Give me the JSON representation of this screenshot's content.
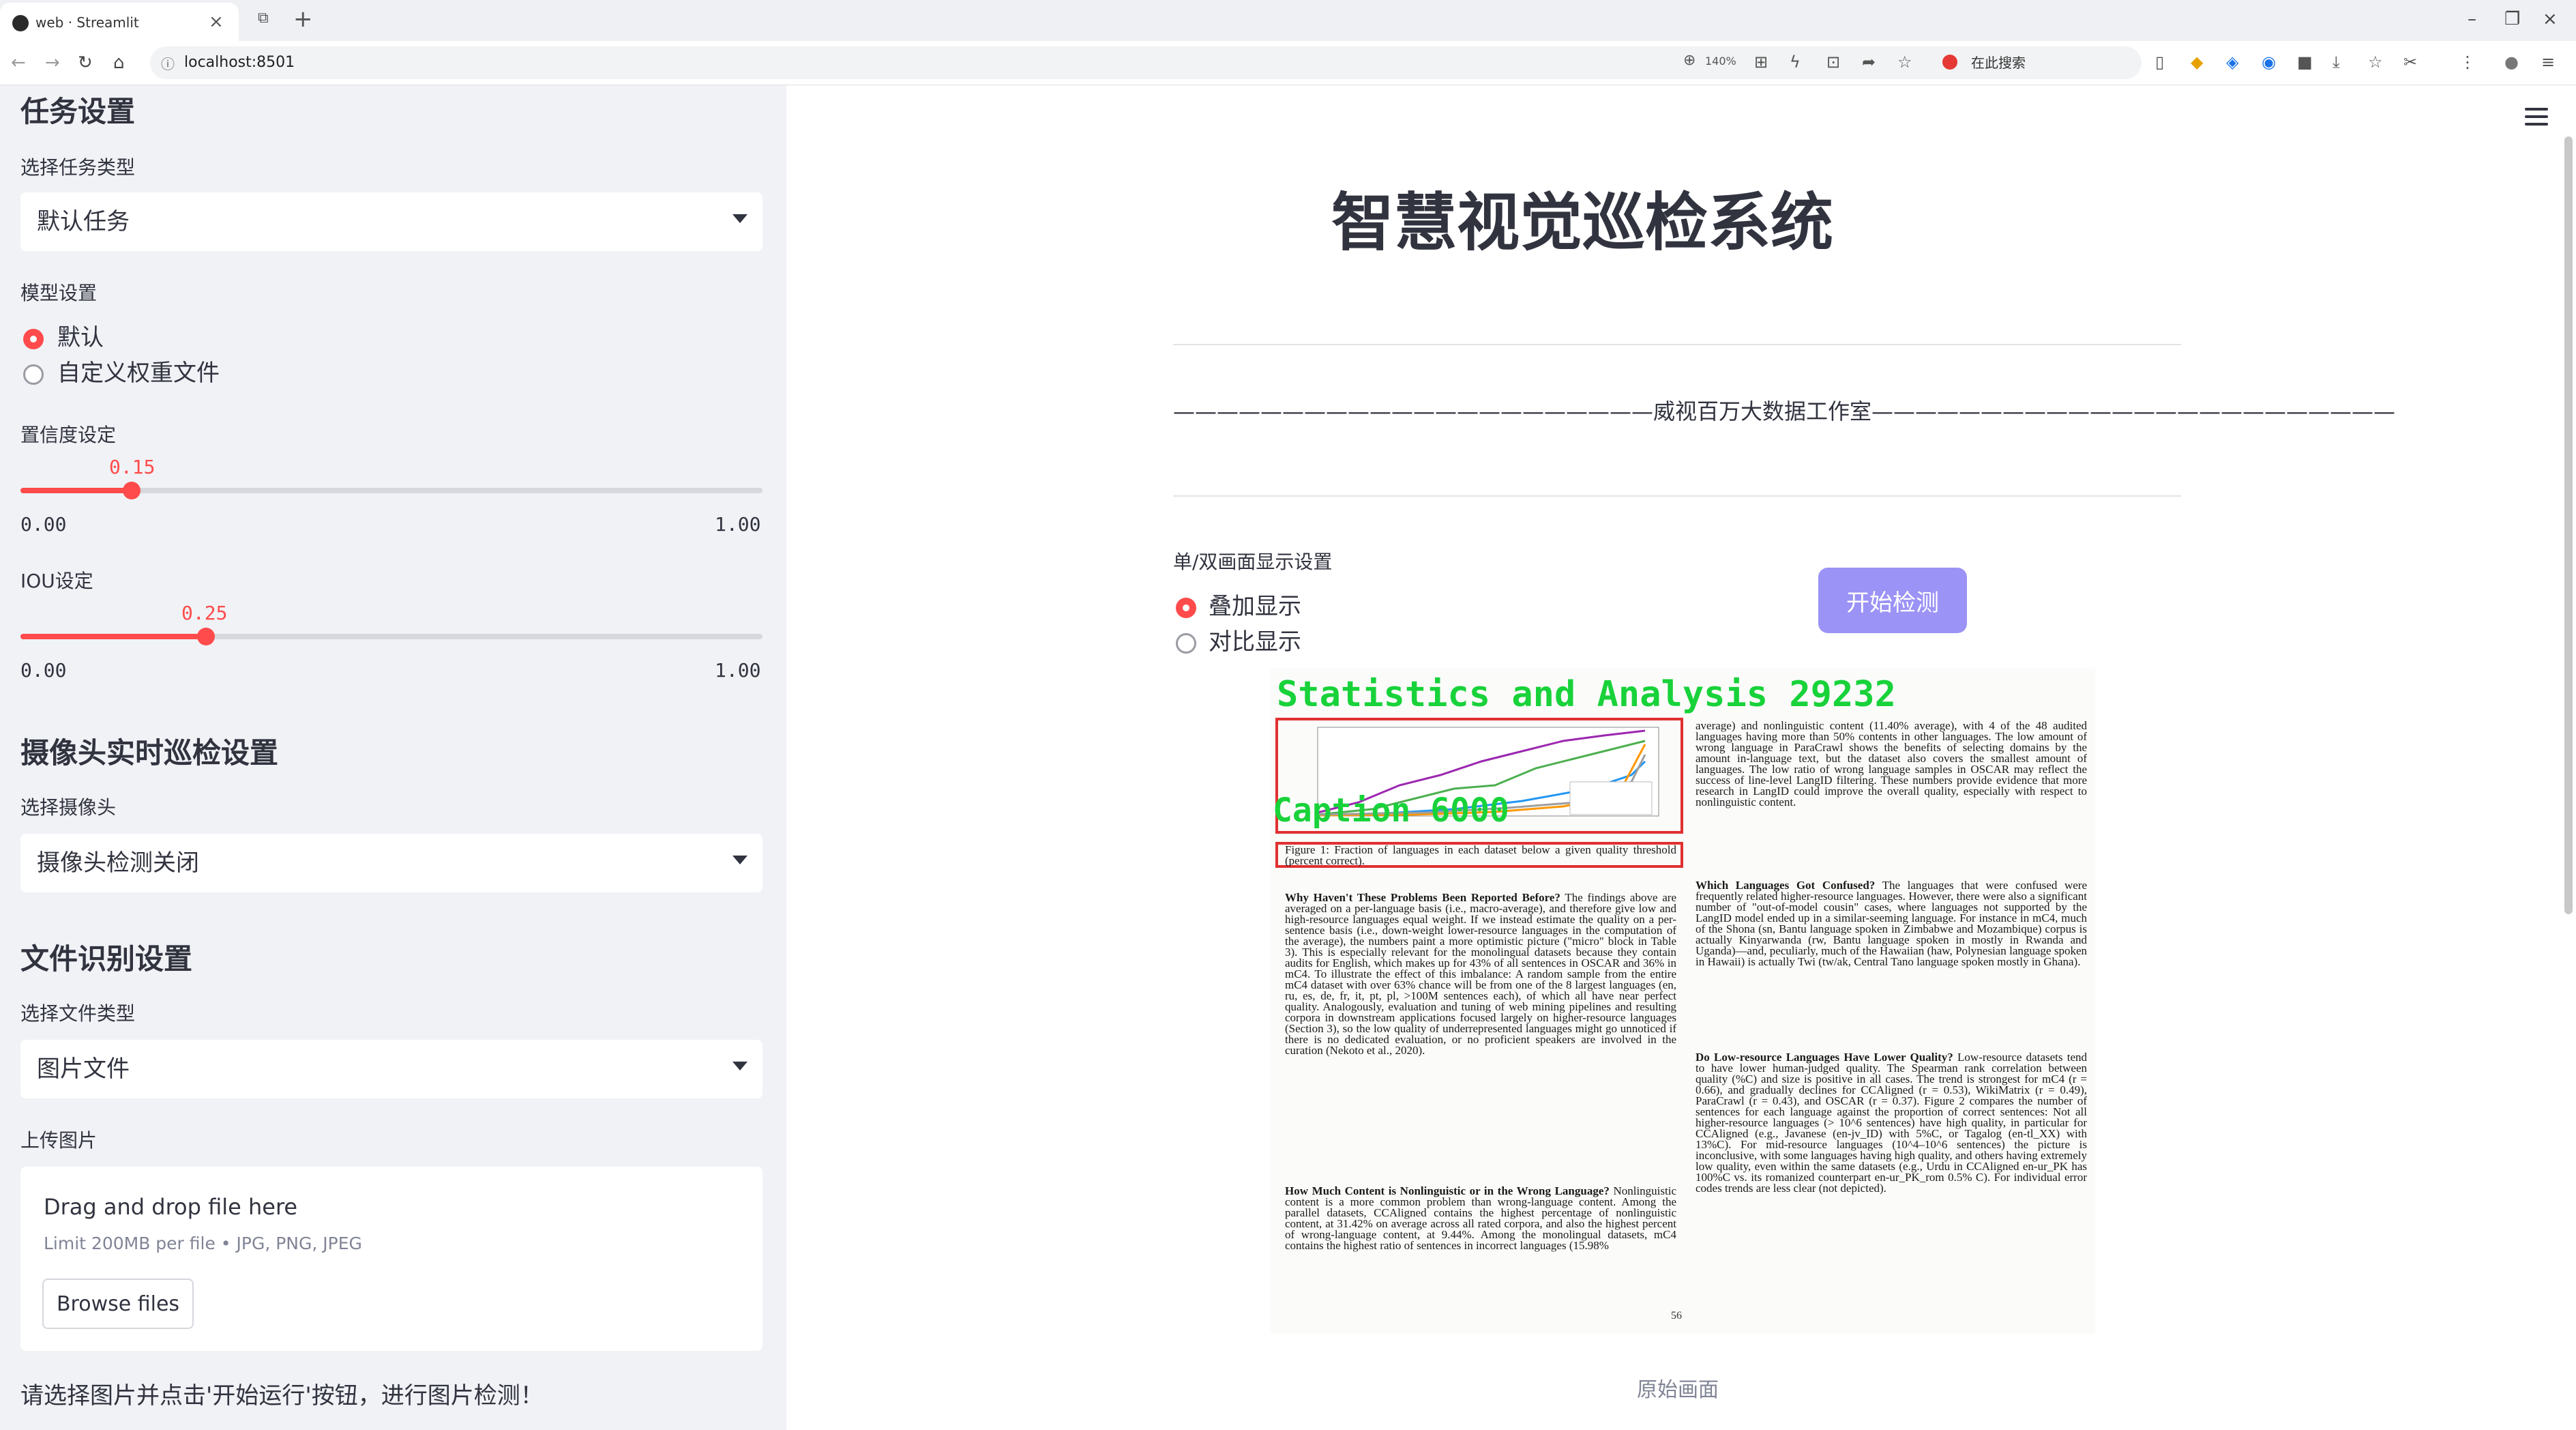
{
  "browser": {
    "tab_title": "web · Streamlit",
    "url": "localhost:8501",
    "zoom": "140%",
    "search_placeholder": "在此搜索"
  },
  "sidebar": {
    "task_section_title": "任务设置",
    "task_type_label": "选择任务类型",
    "task_type_value": "默认任务",
    "model_label": "模型设置",
    "model_options": [
      "默认",
      "自定义权重文件"
    ],
    "model_selected": "默认",
    "confidence_label": "置信度设定",
    "confidence_value": "0.15",
    "confidence_fraction": 0.15,
    "iou_label": "IOU设定",
    "iou_value": "0.25",
    "iou_fraction": 0.25,
    "slider_min": "0.00",
    "slider_max": "1.00",
    "camera_section_title": "摄像头实时巡检设置",
    "camera_label": "选择摄像头",
    "camera_value": "摄像头检测关闭",
    "file_section_title": "文件识别设置",
    "file_type_label": "选择文件类型",
    "file_type_value": "图片文件",
    "upload_label": "上传图片",
    "upload_drag_text": "Drag and drop file here",
    "upload_limit_text": "Limit 200MB per file • JPG, PNG, JPEG",
    "browse_button": "Browse files",
    "hint_text": "请选择图片并点击'开始运行'按钮，进行图片检测！"
  },
  "main": {
    "title": "智慧视觉巡检系统",
    "studio_line": "——————————————————————威视百万大数据工作室————————————————————————",
    "display_label": "单/双画面显示设置",
    "display_options": [
      "叠加显示",
      "对比显示"
    ],
    "display_selected": "叠加显示",
    "start_button": "开始检测",
    "image_caption": "原始画面",
    "detections": [
      {
        "label": "Statistics and Analysis 29232"
      },
      {
        "label": "Caption 6000"
      }
    ],
    "document": {
      "figure_caption": "Figure 1: Fraction of languages in each dataset below a given quality threshold (percent correct).",
      "left_col_p1_head": "Why Haven't These Problems Been Reported Before?",
      "left_col_p1": "The findings above are averaged on a per-language basis (i.e., macro-average), and therefore give low and high-resource languages equal weight. If we instead estimate the quality on a per-sentence basis (i.e., down-weight lower-resource languages in the computation of the average), the numbers paint a more optimistic picture (\"micro\" block in Table 3). This is especially relevant for the monolingual datasets because they contain audits for English, which makes up for 43% of all sentences in OSCAR and 36% in mC4. To illustrate the effect of this imbalance: A random sample from the entire mC4 dataset with over 63% chance will be from one of the 8 largest languages (en, ru, es, de, fr, it, pt, pl, >100M sentences each), of which all have near perfect quality. Analogously, evaluation and tuning of web mining pipelines and resulting corpora in downstream applications focused largely on higher-resource languages (Section 3), so the low quality of underrepresented languages might go unnoticed if there is no dedicated evaluation, or no proficient speakers are involved in the curation (Nekoto et al., 2020).",
      "left_col_p2_head": "How Much Content is Nonlinguistic or in the Wrong Language?",
      "left_col_p2": "Nonlinguistic content is a more common problem than wrong-language content. Among the parallel datasets, CCAligned contains the highest percentage of nonlinguistic content, at 31.42% on average across all rated corpora, and also the highest percent of wrong-language content, at 9.44%. Among the monolingual datasets, mC4 contains the highest ratio of sentences in incorrect languages (15.98%",
      "right_col_p1": "average) and nonlinguistic content (11.40% average), with 4 of the 48 audited languages having more than 50% contents in other languages. The low amount of wrong language in ParaCrawl shows the benefits of selecting domains by the amount in-language text, but the dataset also covers the smallest amount of languages. The low ratio of wrong language samples in OSCAR may reflect the success of line-level LangID filtering. These numbers provide evidence that more research in LangID could improve the overall quality, especially with respect to nonlinguistic content.",
      "right_col_p2_head": "Which Languages Got Confused?",
      "right_col_p2": "The languages that were confused were frequently related higher-resource languages. However, there were also a significant number of \"out-of-model cousin\" cases, where languages not supported by the LangID model ended up in a similar-seeming language. For instance in mC4, much of the Shona (sn, Bantu language spoken in Zimbabwe and Mozambique) corpus is actually Kinyarwanda (rw, Bantu language spoken in mostly in Rwanda and Uganda)—and, peculiarly, much of the Hawaiian (haw, Polynesian language spoken in Hawaii) is actually Twi (tw/ak, Central Tano language spoken mostly in Ghana).",
      "right_col_p3_head": "Do Low-resource Languages Have Lower Quality?",
      "right_col_p3": "Low-resource datasets tend to have lower human-judged quality. The Spearman rank correlation between quality (%C) and size is positive in all cases. The trend is strongest for mC4 (r = 0.66), and gradually declines for CCAligned (r = 0.53), WikiMatrix (r = 0.49), ParaCrawl (r = 0.43), and OSCAR (r = 0.37). Figure 2 compares the number of sentences for each language against the proportion of correct sentences: Not all higher-resource languages (> 10^6 sentences) have high quality, in particular for CCAligned (e.g., Javanese (en-jv_ID) with 5%C, or Tagalog (en-tl_XX) with 13%C). For mid-resource languages (10^4–10^6 sentences) the picture is inconclusive, with some languages having high quality, and others having extremely low quality, even within the same datasets (e.g., Urdu in CCAligned en-ur_PK has 100%C vs. its romanized counterpart en-ur_PK_rom 0.5% C). For individual error codes trends are less clear (not depicted).",
      "page_number": "56",
      "mini_chart_legend": [
        "CCAligned",
        "ParaCrawl",
        "WikiMatrix",
        "OSCAR",
        "mC4"
      ]
    }
  },
  "colors": {
    "accent": "#ff4b4b",
    "sidebar_bg": "#f0f2f6",
    "start_button": "#9b93f5",
    "detection_label": "#18d23a",
    "detection_box": "#e03030"
  },
  "icons": [
    "menu-icon",
    "back-icon",
    "forward-icon",
    "reload-icon",
    "home-icon",
    "caret-down-icon"
  ]
}
